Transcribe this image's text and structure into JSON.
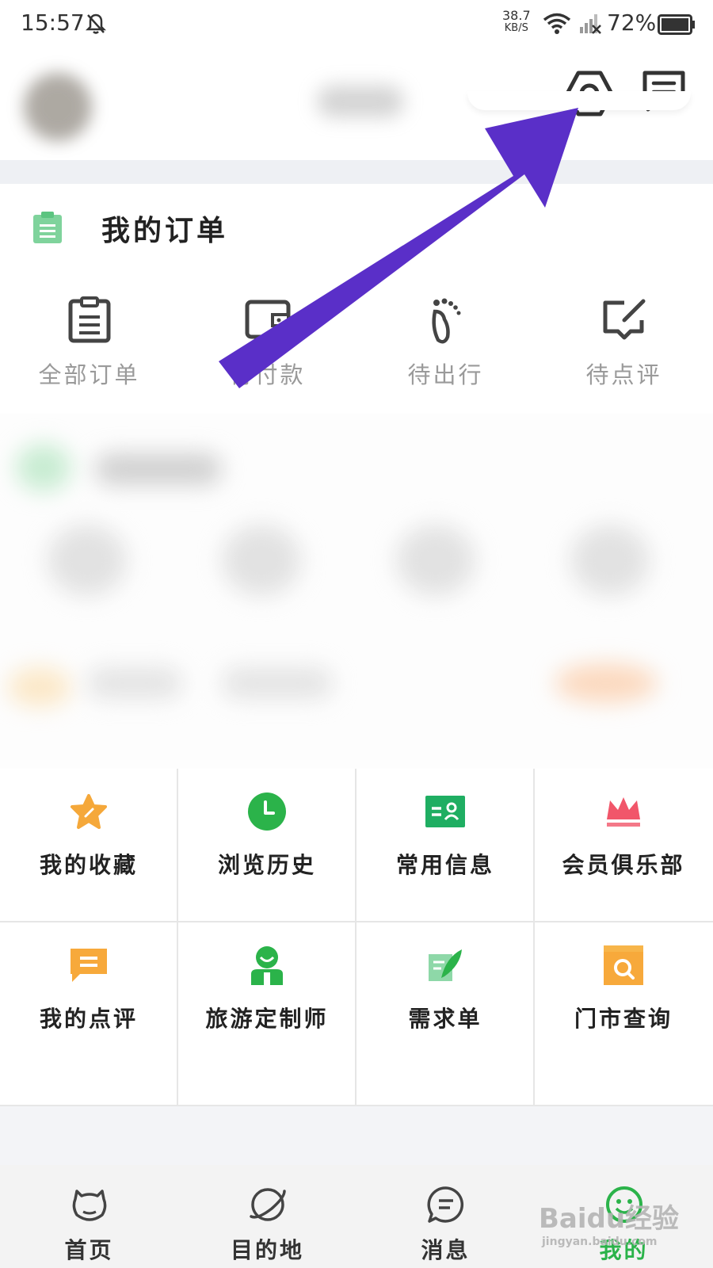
{
  "status_bar": {
    "time": "15:57",
    "net_speed_value": "38.7",
    "net_speed_unit": "KB/S",
    "battery": "72%"
  },
  "header": {
    "settings_icon": "hexagon-settings-icon",
    "message_icon": "message-icon"
  },
  "orders": {
    "title": "我的订单",
    "items": [
      {
        "label": "全部订单",
        "icon": "clipboard-icon"
      },
      {
        "label": "待付款",
        "icon": "wallet-icon"
      },
      {
        "label": "待出行",
        "icon": "footprint-icon"
      },
      {
        "label": "待点评",
        "icon": "edit-comment-icon"
      }
    ]
  },
  "services": [
    {
      "label": "我的收藏",
      "icon": "star-icon"
    },
    {
      "label": "浏览历史",
      "icon": "clock-icon"
    },
    {
      "label": "常用信息",
      "icon": "id-card-icon"
    },
    {
      "label": "会员俱乐部",
      "icon": "crown-icon"
    },
    {
      "label": "我的点评",
      "icon": "comment-icon"
    },
    {
      "label": "旅游定制师",
      "icon": "person-icon"
    },
    {
      "label": "需求单",
      "icon": "quill-icon"
    },
    {
      "label": "门市查询",
      "icon": "store-search-icon"
    }
  ],
  "bottom_nav": [
    {
      "label": "首页",
      "icon": "cow-icon"
    },
    {
      "label": "目的地",
      "icon": "planet-icon"
    },
    {
      "label": "消息",
      "icon": "chat-icon"
    },
    {
      "label": "我的",
      "icon": "smiley-icon",
      "active": true
    }
  ],
  "watermark": {
    "line1": "Baidu经验",
    "line2": "jingyan.baidu.com"
  },
  "colors": {
    "accent_green": "#2bb34a",
    "arrow_purple": "#5a2fc8",
    "text_gray": "#9a9a9a"
  }
}
